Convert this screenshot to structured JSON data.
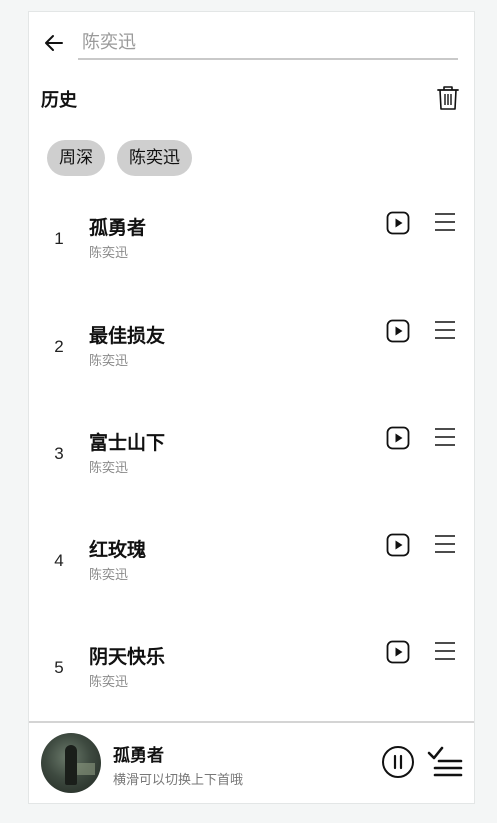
{
  "search": {
    "value": "",
    "placeholder": "陈奕迅"
  },
  "history": {
    "title": "历史",
    "chips": [
      "周深",
      "陈奕迅"
    ]
  },
  "songs": [
    {
      "index": "1",
      "title": "孤勇者",
      "artist": "陈奕迅"
    },
    {
      "index": "2",
      "title": "最佳损友",
      "artist": "陈奕迅"
    },
    {
      "index": "3",
      "title": "富士山下",
      "artist": "陈奕迅"
    },
    {
      "index": "4",
      "title": "红玫瑰",
      "artist": "陈奕迅"
    },
    {
      "index": "5",
      "title": "阴天快乐",
      "artist": "陈奕迅"
    }
  ],
  "player": {
    "title": "孤勇者",
    "hint": "横滑可以切换上下首哦",
    "state": "playing"
  },
  "icons": {
    "back": "arrow-left-icon",
    "trash": "trash-icon",
    "play": "play-square-icon",
    "menu": "hamburger-menu-icon",
    "pause": "pause-circle-icon",
    "queue": "playlist-check-icon"
  }
}
